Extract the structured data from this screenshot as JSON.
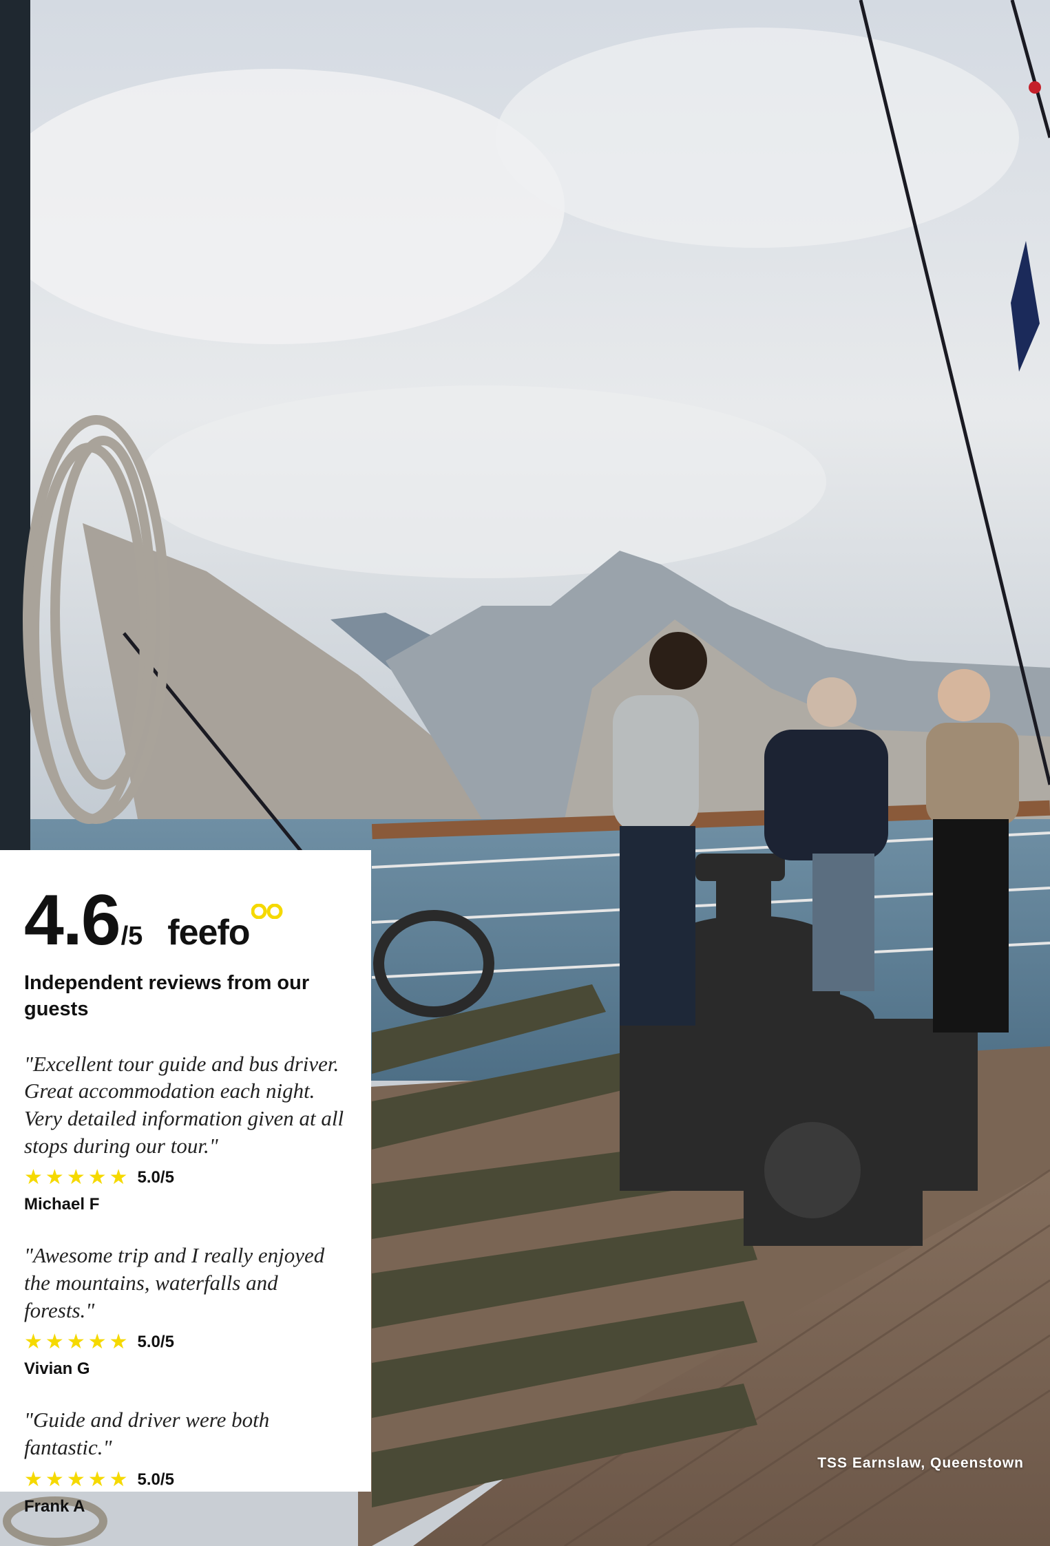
{
  "rating": {
    "score": "4.6",
    "out_of": "/5",
    "brand": "feefo",
    "subtitle": "Independent reviews from our guests"
  },
  "reviews": [
    {
      "quote": "\"Excellent tour guide and bus driver. Great accommodation each night. Very detailed information given at all stops during our tour.\"",
      "stars": 5,
      "rating": "5.0/5",
      "author": "Michael F"
    },
    {
      "quote": "\"Awesome trip and I really enjoyed the mountains, waterfalls and forests.\"",
      "stars": 5,
      "rating": "5.0/5",
      "author": "Vivian G"
    },
    {
      "quote": "\"Guide and driver were both fantastic.\"",
      "stars": 5,
      "rating": "5.0/5",
      "author": "Frank A"
    }
  ],
  "caption": "TSS Earnslaw, Queenstown",
  "colors": {
    "star": "#f5d900",
    "brand_accent": "#f5d900",
    "panel": "#ffffff"
  }
}
